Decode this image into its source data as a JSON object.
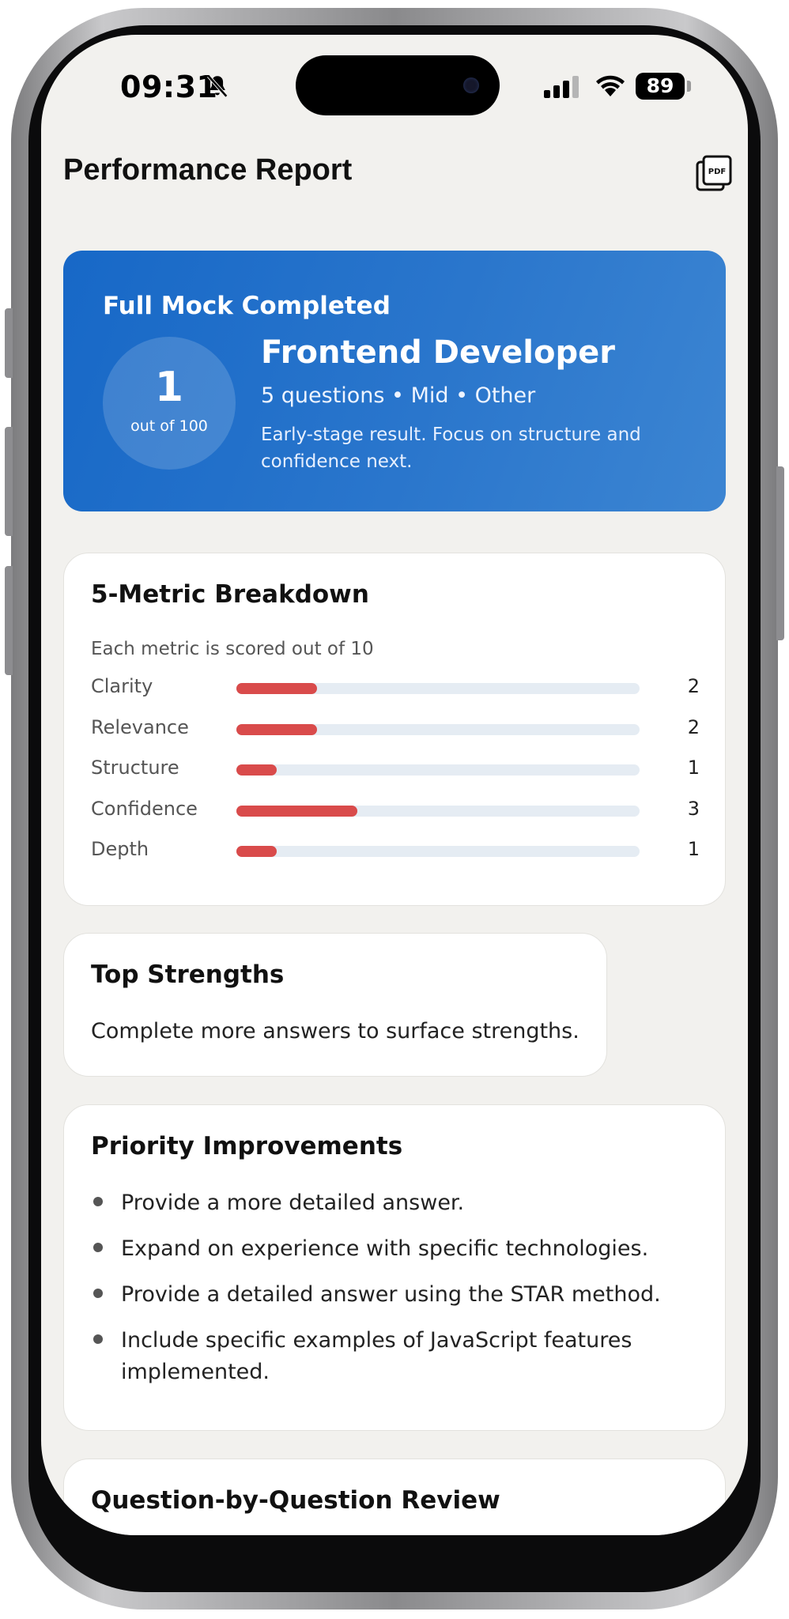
{
  "status_bar": {
    "time": "09:31",
    "battery": "89",
    "icons": [
      "bell-slash-icon",
      "cellular-signal-icon",
      "wifi-icon",
      "battery-icon"
    ]
  },
  "header": {
    "title": "Performance Report",
    "pdf_icon": "pdf-export-icon",
    "pdf_label": "PDF"
  },
  "hero": {
    "kicker": "Full Mock Completed",
    "score": "1",
    "score_caption": "out of 100",
    "role": "Frontend Developer",
    "meta": "5 questions • Mid • Other",
    "note": "Early-stage result. Focus on structure and confidence next.",
    "color_start": "#1768c7",
    "color_end": "#3c85d2"
  },
  "metrics": {
    "title": "5-Metric Breakdown",
    "caption": "Each metric is scored out of 10",
    "max": 10,
    "bar_color": "#d94b4b",
    "track_color": "#e5ecf3",
    "items": [
      {
        "label": "Clarity",
        "value": 2
      },
      {
        "label": "Relevance",
        "value": 2
      },
      {
        "label": "Structure",
        "value": 1
      },
      {
        "label": "Confidence",
        "value": 3
      },
      {
        "label": "Depth",
        "value": 1
      }
    ]
  },
  "strengths": {
    "title": "Top Strengths",
    "text": "Complete more answers to surface strengths."
  },
  "improvements": {
    "title": "Priority Improvements",
    "items": [
      "Provide a more detailed answer.",
      "Expand on experience with specific technologies.",
      "Provide a detailed answer using the STAR method.",
      "Include specific examples of JavaScript features implemented."
    ]
  },
  "review": {
    "title": "Question-by-Question Review"
  }
}
